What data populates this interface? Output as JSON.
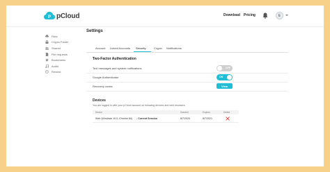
{
  "brand": {
    "name": "pCloud",
    "accent": "#20bed6"
  },
  "topbar": {
    "download": "Download",
    "pricing": "Pricing",
    "bell_icon": "bell-icon",
    "avatar_initial": "E"
  },
  "sidebar": {
    "items": [
      {
        "label": "Files",
        "icon": "cloud-icon"
      },
      {
        "label": "Crypto Folder",
        "icon": "lock-icon"
      },
      {
        "label": "Shared",
        "icon": "share-icon"
      },
      {
        "label": "File requests",
        "icon": "file-request-icon"
      },
      {
        "label": "Bookmarks",
        "icon": "star-icon"
      },
      {
        "label": "Audio",
        "icon": "music-icon"
      },
      {
        "label": "Rewind",
        "icon": "rewind-icon"
      }
    ]
  },
  "settings": {
    "title": "Settings",
    "tabs": [
      "Account",
      "Linked Accounts",
      "Security",
      "Crypto",
      "Notifications"
    ],
    "active_tab": "Security"
  },
  "two_factor": {
    "title": "Two-Factor Authentication",
    "rows": [
      {
        "label": "Text messages and system notifications",
        "control": "toggle",
        "state": "OFF"
      },
      {
        "label": "Google Authenticator",
        "control": "toggle",
        "state": "ON"
      },
      {
        "label": "Recovery codes",
        "control": "button",
        "button_label": "View"
      }
    ]
  },
  "devices": {
    "title": "Devices",
    "description": "You are logged in with your pCloud account on following devices and web browsers.",
    "columns": [
      "Device",
      "Granted",
      "Expires",
      "Delete"
    ],
    "rows": [
      {
        "device": "Web (Windows 10.0, Chrome 84)",
        "current": "- Current Session",
        "granted": "8/7/2020",
        "expires": "8/7/2021"
      }
    ]
  }
}
